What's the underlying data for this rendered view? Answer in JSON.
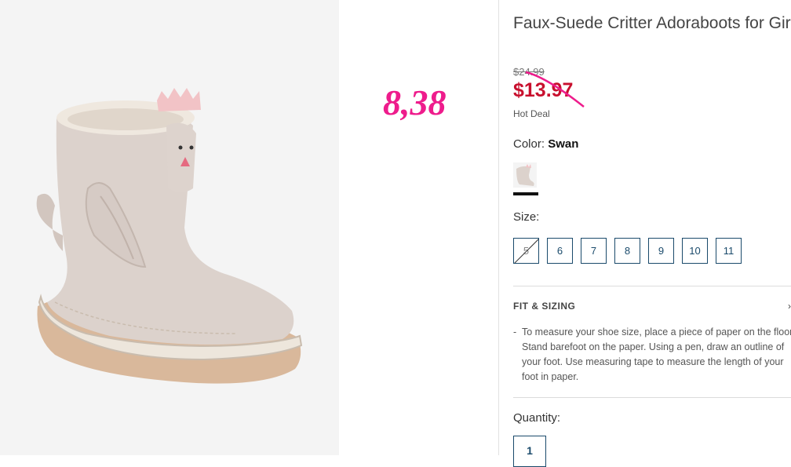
{
  "product": {
    "title": "Faux-Suede Critter Adoraboots for Girls",
    "old_price": "$24.99",
    "new_price": "$13.97",
    "deal_label": "Hot Deal"
  },
  "annotation": {
    "text": "8,38",
    "color": "#ee1c8c"
  },
  "color": {
    "label": "Color:",
    "value": "Swan"
  },
  "size": {
    "label": "Size:",
    "options": [
      "5",
      "6",
      "7",
      "8",
      "9",
      "10",
      "11"
    ],
    "unavailable": [
      "5"
    ]
  },
  "fit": {
    "title": "FIT & SIZING",
    "bullet": "-",
    "text": "To measure your shoe size, place a piece of paper on the floor. Stand barefoot on the paper. Using a pen, draw an outline of your foot. Use measuring tape to measure the length of your foot in paper.",
    "chevron": "›"
  },
  "quantity": {
    "label": "Quantity:",
    "value": "1"
  },
  "colors": {
    "price_red": "#c8102e",
    "accent_navy": "#1a4a6b"
  }
}
